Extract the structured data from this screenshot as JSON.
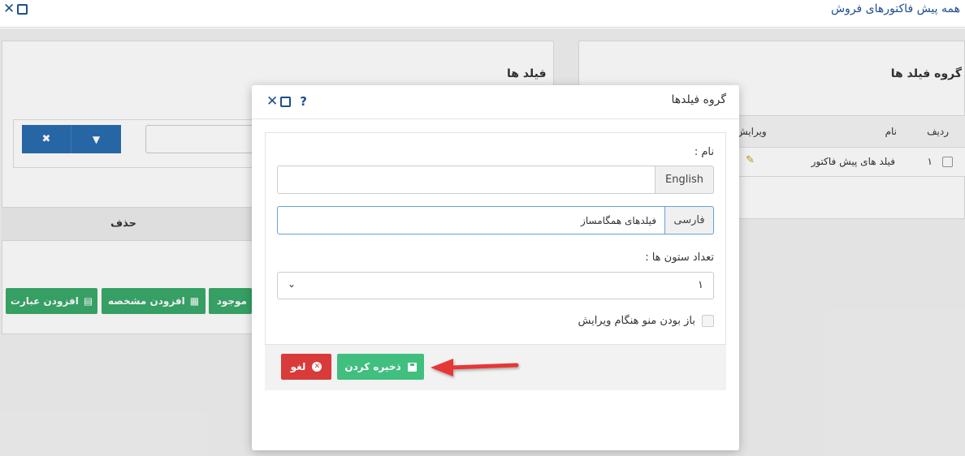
{
  "window": {
    "title": "همه پیش فاکتورهای فروش"
  },
  "background": {
    "left_panel": {
      "title": "فیلد ها",
      "delete_header": "حذف",
      "buttons": [
        "افزودن عبارت",
        "افزودن مشخصه",
        "موجود"
      ]
    },
    "right_panel": {
      "title": "گروه فیلد ها",
      "columns": [
        "ردیف",
        "نام",
        "ویرایش"
      ],
      "rows": [
        {
          "index": "۱",
          "name": "فیلد های پیش فاکتور"
        }
      ]
    }
  },
  "modal": {
    "title": "گروه فیلدها",
    "help": "?",
    "name_label": "نام :",
    "english_addon": "English",
    "english_value": "",
    "farsi_addon": "فارسی",
    "farsi_value": "فیلدهای همگامساز",
    "columns_label": "تعداد ستون ها :",
    "columns_value": "۱",
    "menu_open_label": "باز بودن منو هنگام ویرایش",
    "save_label": "ذخیره کردن",
    "cancel_label": "لغو"
  },
  "colors": {
    "primary": "#2a6db0",
    "success": "#40bf7f",
    "danger": "#d93a3a",
    "title_blue": "#1f4e8c",
    "arrow": "#e53935"
  }
}
